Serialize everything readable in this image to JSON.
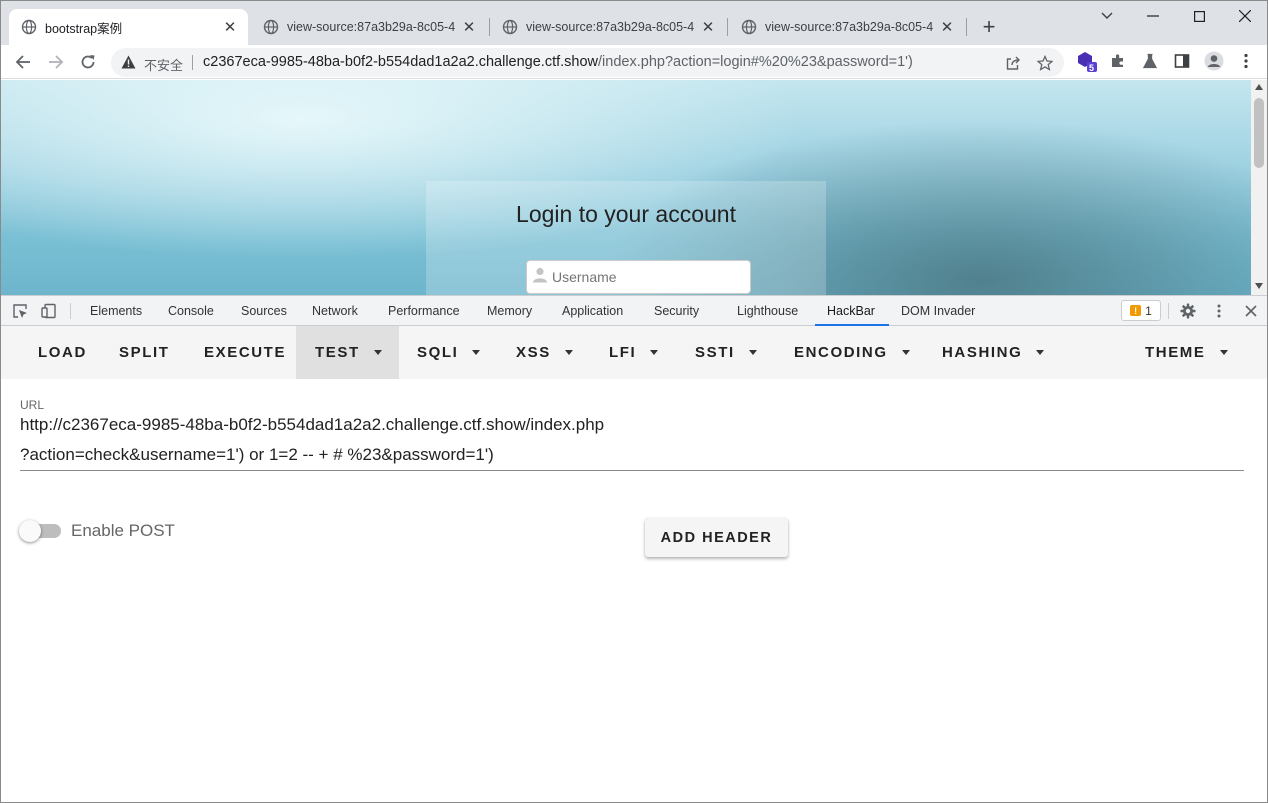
{
  "browser": {
    "tabs": [
      {
        "title": "bootstrap案例",
        "active": true
      },
      {
        "title": "view-source:87a3b29a-8c05-4",
        "active": false
      },
      {
        "title": "view-source:87a3b29a-8c05-4",
        "active": false
      },
      {
        "title": "view-source:87a3b29a-8c05-4",
        "active": false
      }
    ],
    "new_tab_label": "+",
    "security_label": "不安全",
    "url_host": "c2367eca-9985-48ba-b0f2-b554dad1a2a2.challenge.ctf.show",
    "url_path": "/index.php?action=login#%20%23&password=1')",
    "extension_badge": "5"
  },
  "page": {
    "login_title": "Login to your account",
    "username_placeholder": "Username"
  },
  "devtools": {
    "tabs": [
      "Elements",
      "Console",
      "Sources",
      "Network",
      "Performance",
      "Memory",
      "Application",
      "Security",
      "Lighthouse",
      "HackBar",
      "DOM Invader"
    ],
    "active_tab": "HackBar",
    "issues_count": "1"
  },
  "hackbar": {
    "menu": [
      {
        "label": "LOAD",
        "dropdown": false
      },
      {
        "label": "SPLIT",
        "dropdown": false
      },
      {
        "label": "EXECUTE",
        "dropdown": false
      },
      {
        "label": "TEST",
        "dropdown": true,
        "selected": true
      },
      {
        "label": "SQLI",
        "dropdown": true
      },
      {
        "label": "XSS",
        "dropdown": true
      },
      {
        "label": "LFI",
        "dropdown": true
      },
      {
        "label": "SSTI",
        "dropdown": true
      },
      {
        "label": "ENCODING",
        "dropdown": true
      },
      {
        "label": "HASHING",
        "dropdown": true
      },
      {
        "label": "THEME",
        "dropdown": true
      }
    ],
    "url_label": "URL",
    "url_line1": "http://c2367eca-9985-48ba-b0f2-b554dad1a2a2.challenge.ctf.show/index.php",
    "url_line2": "?action=check&username=1') or 1=2 -- + # %23&password=1')",
    "enable_post_label": "Enable POST",
    "enable_post_on": false,
    "add_header_label": "ADD HEADER"
  },
  "colors": {
    "devtools_active_underline": "#1a73e8",
    "extension_badge": "#5b3fd6",
    "issues_flag": "#f29900"
  }
}
